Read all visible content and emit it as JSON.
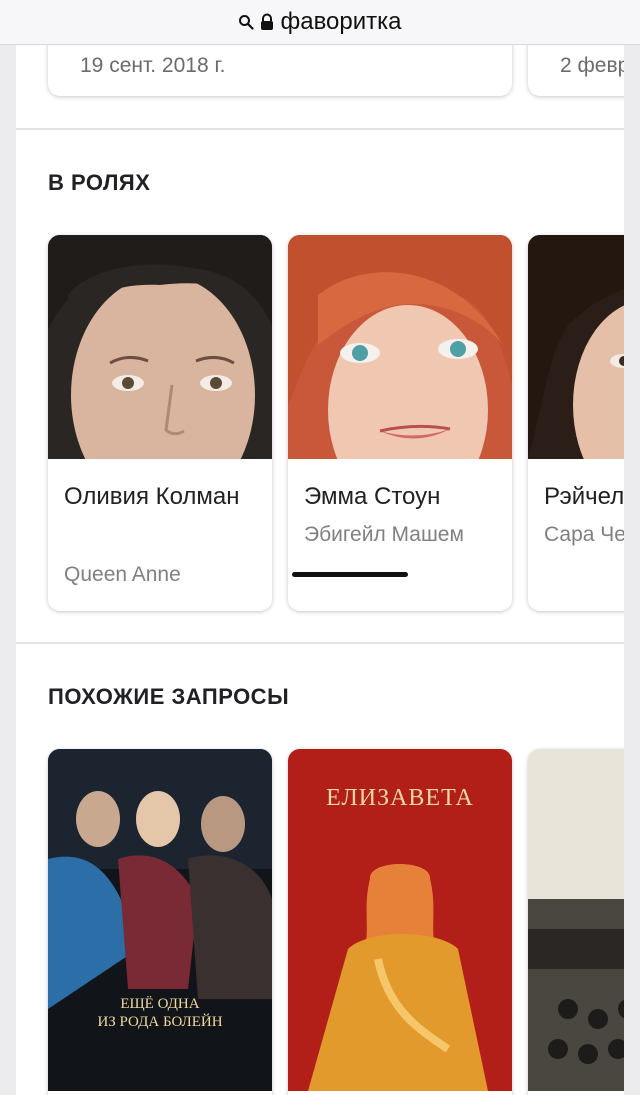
{
  "browser": {
    "url": "фаворитка"
  },
  "release_dates": [
    "19 сент. 2018 г.",
    "2 февр"
  ],
  "cast": {
    "title": "В РОЛЯХ",
    "actors": [
      {
        "name": "Оливия Колман",
        "role": "Queen Anne"
      },
      {
        "name": "Эмма Стоун",
        "role": "Эбигейл Машем"
      },
      {
        "name": "Рэйчел",
        "role": "Сара Чер"
      }
    ]
  },
  "related": {
    "title": "ПОХОЖИЕ ЗАПРОСЫ",
    "items": [
      {
        "poster_text_line1": "ЕЩЁ ОДНА",
        "poster_text_line2": "ИЗ РОДА БОЛЕЙН"
      },
      {
        "poster_text": "ЕЛИЗАВЕТА"
      },
      {
        "poster_text": ""
      }
    ]
  }
}
